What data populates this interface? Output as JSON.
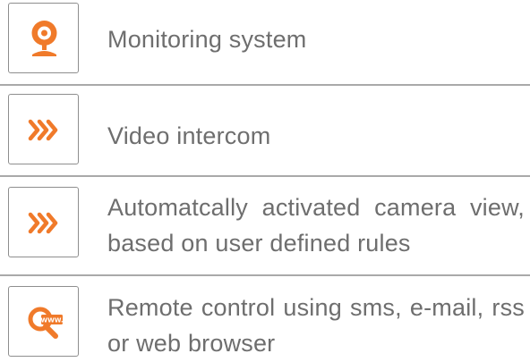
{
  "features": [
    {
      "icon": "webcam-icon",
      "text": "Monitoring system"
    },
    {
      "icon": "triple-chevron-right-icon",
      "text": "Video intercom"
    },
    {
      "icon": "triple-chevron-right-icon",
      "text": "Automatcally activated camera view, based on user defined rules"
    },
    {
      "icon": "web-search-icon",
      "icon_text": "WWW.",
      "text": "Remote control using sms, e-mail, rss or web browser"
    }
  ],
  "colors": {
    "accent": "#f07a2a",
    "text": "#6e6e6e",
    "border": "#8e8e8e",
    "divider": "#a9a9a9"
  }
}
